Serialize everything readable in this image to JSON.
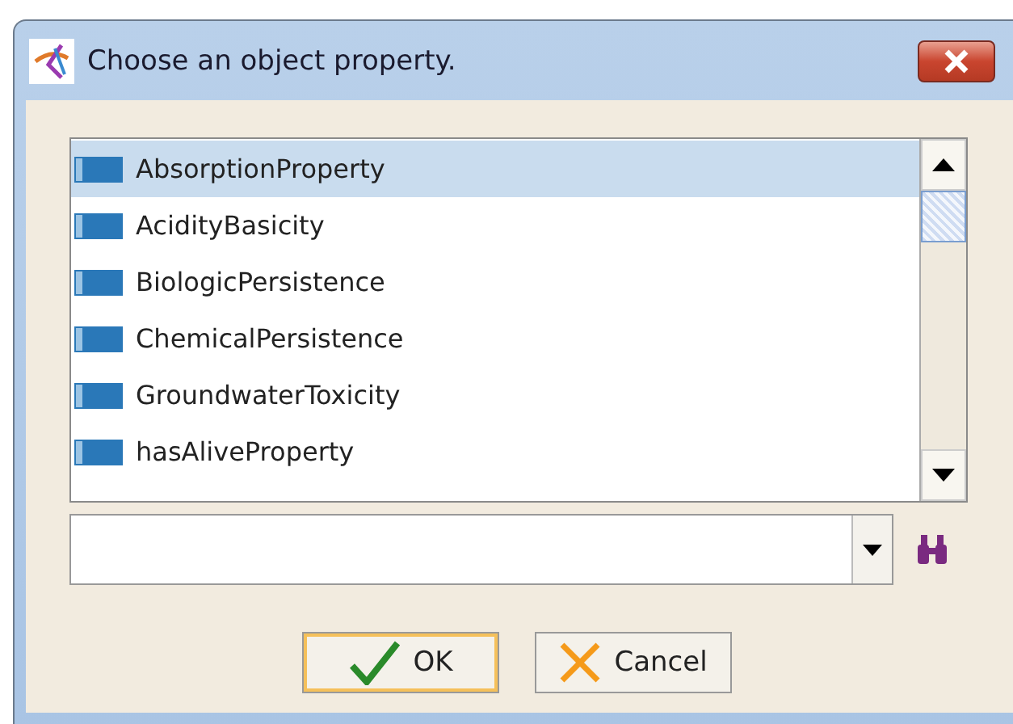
{
  "window": {
    "title": "Choose an object property."
  },
  "list": {
    "items": [
      {
        "label": "AbsorptionProperty",
        "selected": true
      },
      {
        "label": "AcidityBasicity",
        "selected": false
      },
      {
        "label": "BiologicPersistence",
        "selected": false
      },
      {
        "label": "ChemicalPersistence",
        "selected": false
      },
      {
        "label": "GroundwaterToxicity",
        "selected": false
      },
      {
        "label": "hasAliveProperty",
        "selected": false
      }
    ]
  },
  "buttons": [
    {
      "label": "OK",
      "kind": "ok",
      "default": true
    },
    {
      "label": "Cancel",
      "kind": "cancel",
      "default": false
    }
  ]
}
